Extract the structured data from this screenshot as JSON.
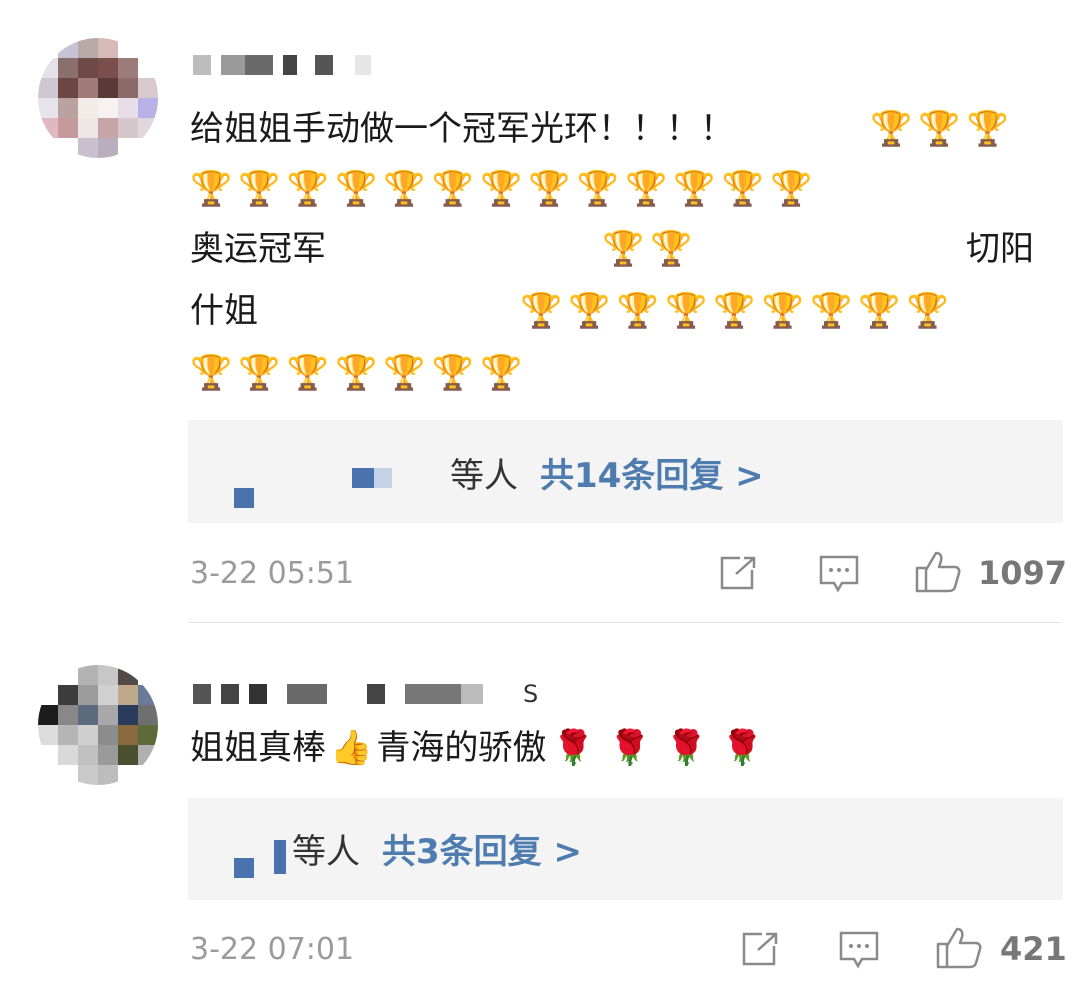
{
  "comments": [
    {
      "text_lines": [
        "给姐姐手动做一个冠军光环！！！！",
        "🏆🏆🏆",
        "🏆🏆🏆🏆🏆🏆🏆🏆🏆🏆🏆🏆🏆",
        "奥运冠军",
        "🏆🏆",
        "切阳",
        "什姐",
        "🏆🏆🏆🏆🏆🏆🏆🏆🏆",
        "🏆🏆🏆🏆🏆🏆🏆"
      ],
      "replies": {
        "suffix": "等人",
        "count_label": "共14条回复 >"
      },
      "time": "3-22 05:51",
      "likes": "1097"
    },
    {
      "text_prefix": "姐姐真棒",
      "text_emoji": "👍",
      "text_suffix": "青海的骄傲",
      "roses": "🌹🌹🌹🌹",
      "username_glyph": "S",
      "replies": {
        "suffix": "等人",
        "count_label": "共3条回复 >"
      },
      "time": "3-22 07:01",
      "likes": "421"
    }
  ],
  "colors": {
    "link": "#4f7cae",
    "meta": "#9b9b9b",
    "reply_bg": "#f4f4f4"
  },
  "icons": [
    "share-icon",
    "comment-icon",
    "like-icon"
  ]
}
